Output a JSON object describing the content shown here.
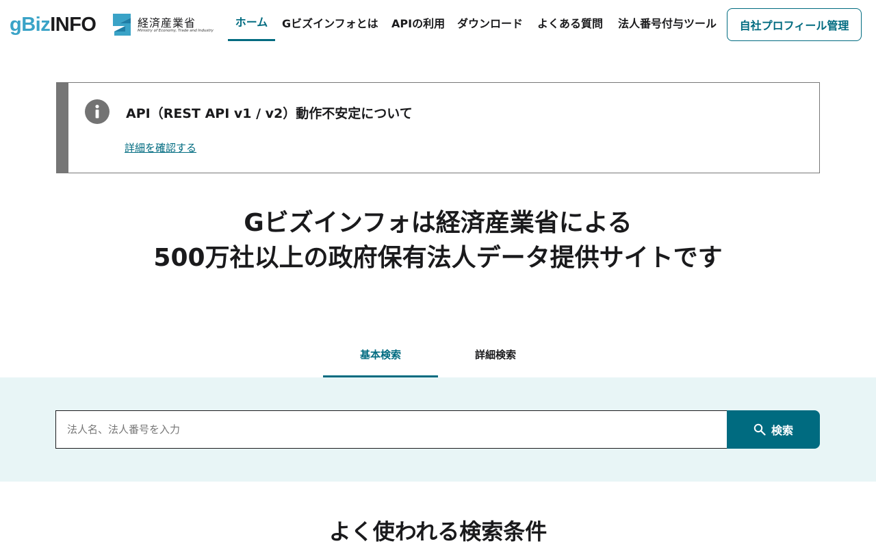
{
  "header": {
    "logo_g": "gBiz",
    "logo_info": "INFO",
    "meti_name": "経済産業省",
    "meti_sub": "Ministry of Economy, Trade and Industry",
    "nav": [
      {
        "label": "ホーム",
        "active": true
      },
      {
        "label": "Gビズインフォとは"
      },
      {
        "label": "APIの利用"
      },
      {
        "label": "ダウンロード"
      },
      {
        "label": "よくある質問"
      },
      {
        "label": "法人番号付与ツール"
      }
    ],
    "profile_button": "自社プロフィール管理"
  },
  "notice": {
    "icon": "info-icon",
    "title": "API（REST API v1 / v2）動作不安定について",
    "link": "詳細を確認する"
  },
  "hero": {
    "line1": "Gビズインフォは経済産業省による",
    "line2": "500万社以上の政府保有法人データ提供サイトです"
  },
  "tabs": [
    {
      "label": "基本検索",
      "active": true
    },
    {
      "label": "詳細検索"
    }
  ],
  "search": {
    "placeholder": "法人名、法人番号を入力",
    "value": "",
    "button_label": "検索",
    "button_icon": "search-icon"
  },
  "section": {
    "heading": "よく使われる検索条件"
  },
  "colors": {
    "accent": "#006b80",
    "logo_blue": "#3aa3c7",
    "search_band_bg": "#e8f5f6",
    "notice_bar": "#767676"
  }
}
